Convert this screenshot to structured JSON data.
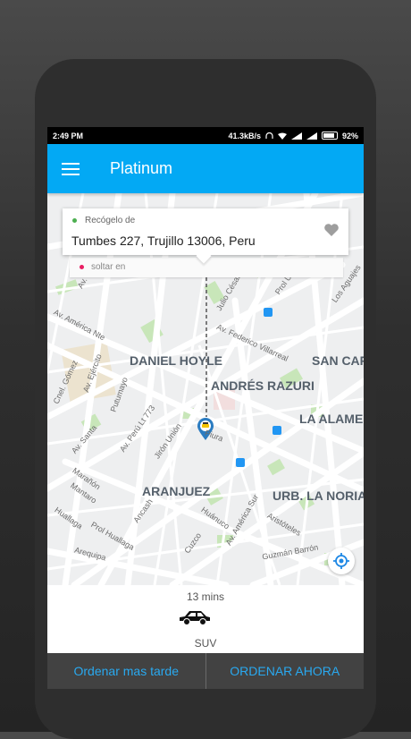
{
  "status_bar": {
    "time": "2:49 PM",
    "speed": "41.3kB/s",
    "battery": "92%"
  },
  "app_bar": {
    "title": "Platinum",
    "menu_icon": "hamburger-menu-icon",
    "color": "#03a9f4"
  },
  "pickup": {
    "label": "Recógelo de",
    "address": "Tumbes 227, Trujillo 13006, Peru",
    "favorite_icon": "heart-icon"
  },
  "dropoff": {
    "label": "soltar en"
  },
  "map": {
    "districts": [
      "DANIEL HOYLE",
      "SAN CAR",
      "ANDRÉS RAZURI",
      "LA ALAME",
      "ARANJUEZ",
      "URB. LA NORIA"
    ],
    "streets": [
      "Av. América Nte",
      "Av. Federico Villarreal",
      "Julio César",
      "Prol Unión",
      "Los Aguajes",
      "Cnel. Gómez",
      "Av. Ejército",
      "Putumayo",
      "Av. Perú Lt 773",
      "Jirón Unión",
      "Av. Santa",
      "Marañón",
      "Mantaro",
      "Huallaga",
      "Prol Huallaga",
      "Arequipa",
      "Ancash",
      "Huánuco",
      "Cuzco",
      "Piura",
      "Av. América Sur",
      "Aristóteles",
      "Guzmán Barrón",
      "Av. Mi"
    ],
    "pin_icon": "taxi-pin-icon",
    "locate_icon": "my-location-icon"
  },
  "vehicle": {
    "eta": "13 mins",
    "icon": "car-icon",
    "type": "SUV"
  },
  "actions": {
    "later": "Ordenar mas tarde",
    "now": "ORDENAR AHORA",
    "accent": "#29a9f0"
  }
}
